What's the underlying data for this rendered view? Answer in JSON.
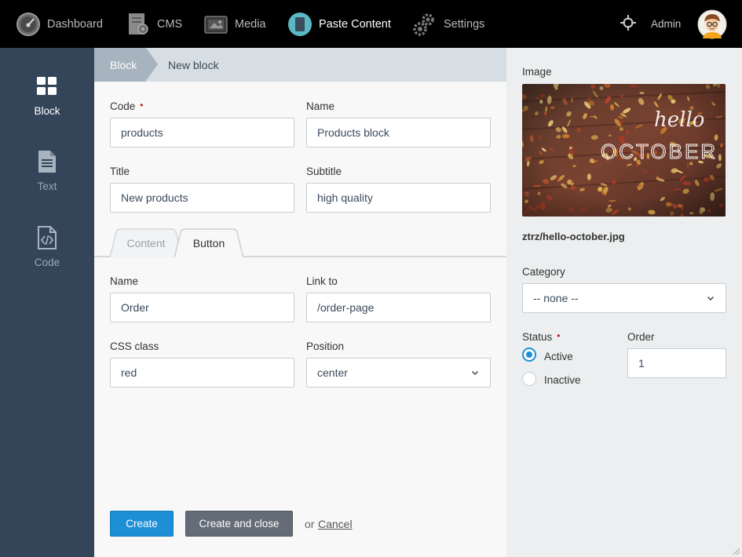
{
  "topnav": {
    "items": [
      {
        "label": "Dashboard",
        "icon": "speedometer-icon"
      },
      {
        "label": "CMS",
        "icon": "cms-icon"
      },
      {
        "label": "Media",
        "icon": "media-icon"
      },
      {
        "label": "Paste Content",
        "icon": "paste-content-icon"
      },
      {
        "label": "Settings",
        "icon": "gears-icon"
      }
    ],
    "user": "Admin"
  },
  "sidebar": {
    "items": [
      {
        "label": "Block",
        "icon": "grid-icon"
      },
      {
        "label": "Text",
        "icon": "document-icon"
      },
      {
        "label": "Code",
        "icon": "code-file-icon"
      }
    ]
  },
  "breadcrumb": [
    "Block",
    "New block"
  ],
  "form": {
    "code": {
      "label": "Code",
      "value": "products"
    },
    "name": {
      "label": "Name",
      "value": "Products block"
    },
    "title": {
      "label": "Title",
      "value": "New products"
    },
    "subtitle": {
      "label": "Subtitle",
      "value": "high quality"
    },
    "required_mark": "•"
  },
  "tabs": [
    "Content",
    "Button"
  ],
  "button_tab": {
    "name": {
      "label": "Name",
      "value": "Order"
    },
    "link": {
      "label": "Link to",
      "value": "/order-page"
    },
    "css": {
      "label": "CSS class",
      "value": "red"
    },
    "position": {
      "label": "Position",
      "value": "center"
    }
  },
  "actions": {
    "create": "Create",
    "create_close": "Create and close",
    "or": "or",
    "cancel": "Cancel"
  },
  "right": {
    "image_label": "Image",
    "image_text_1": "hello",
    "image_text_2": "OCTOBER",
    "file_name": "ztrz/hello-october.jpg",
    "category_label": "Category",
    "category_value": "-- none --",
    "status_label": "Status",
    "status_options": [
      "Active",
      "Inactive"
    ],
    "order_label": "Order",
    "order_value": "1"
  },
  "colors": {
    "accent": "#1d8fd6",
    "sidebar": "#34455a",
    "required": "#c0161a"
  }
}
